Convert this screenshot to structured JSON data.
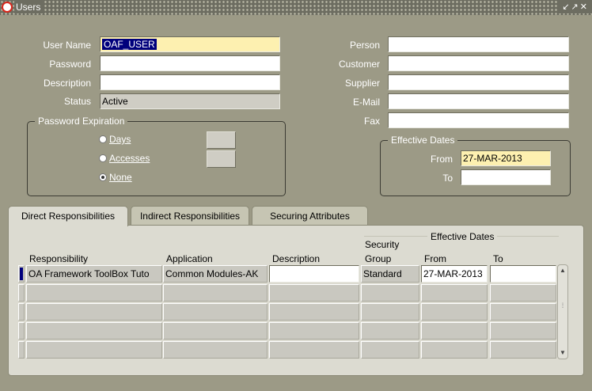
{
  "window": {
    "title": "Users",
    "controls": "↙↗✕"
  },
  "form": {
    "left": [
      {
        "label": "User Name",
        "value": "OAF_USER"
      },
      {
        "label": "Password",
        "value": ""
      },
      {
        "label": "Description",
        "value": ""
      },
      {
        "label": "Status",
        "value": "Active"
      }
    ],
    "right": [
      {
        "label": "Person",
        "value": ""
      },
      {
        "label": "Customer",
        "value": ""
      },
      {
        "label": "Supplier",
        "value": ""
      },
      {
        "label": "E-Mail",
        "value": ""
      },
      {
        "label": "Fax",
        "value": ""
      }
    ]
  },
  "password_expiration": {
    "title": "Password Expiration",
    "options": [
      {
        "label": "Days",
        "selected": false
      },
      {
        "label": "Accesses",
        "selected": false
      },
      {
        "label": "None",
        "selected": true
      }
    ]
  },
  "effective_dates": {
    "title": "Effective Dates",
    "from_label": "From",
    "from_value": "27-MAR-2013",
    "to_label": "To",
    "to_value": ""
  },
  "tabs": [
    {
      "label": "Direct Responsibilities",
      "active": true
    },
    {
      "label": "Indirect Responsibilities",
      "active": false
    },
    {
      "label": "Securing Attributes",
      "active": false
    }
  ],
  "table": {
    "group_header": "Effective Dates",
    "columns": {
      "responsibility": "Responsibility",
      "application": "Application",
      "description": "Description",
      "security_group_1": "Security",
      "security_group_2": "Group",
      "from": "From",
      "to": "To"
    },
    "rows": [
      {
        "responsibility": "OA Framework ToolBox Tuto",
        "application": "Common Modules-AK",
        "description": "",
        "security_group": "Standard",
        "from": "27-MAR-2013",
        "to": ""
      }
    ]
  },
  "colors": {
    "background": "#9c9a86",
    "selection": "#00007c",
    "required_field": "#fdf0b0"
  }
}
